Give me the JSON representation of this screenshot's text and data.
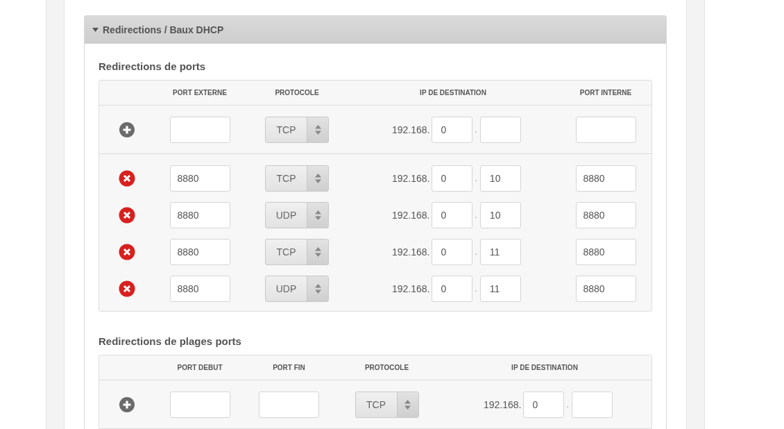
{
  "panel": {
    "title": "Redirections / Baux DHCP",
    "expanded": true
  },
  "port_forwards": {
    "title": "Redirections de ports",
    "columns": [
      "PORT EXTERNE",
      "PROTOCOLE",
      "IP DE DESTINATION",
      "PORT INTERNE"
    ],
    "new_row": {
      "protocol": "TCP",
      "ip_prefix": "192.168.",
      "ip_3": "0",
      "ip_sep": "."
    },
    "rows": [
      {
        "external_port": "8880",
        "protocol": "TCP",
        "ip_prefix": "192.168.",
        "ip_3": "0",
        "ip_sep": ".",
        "ip_4": "10",
        "internal_port": "8880"
      },
      {
        "external_port": "8880",
        "protocol": "UDP",
        "ip_prefix": "192.168.",
        "ip_3": "0",
        "ip_sep": ".",
        "ip_4": "10",
        "internal_port": "8880"
      },
      {
        "external_port": "8880",
        "protocol": "TCP",
        "ip_prefix": "192.168.",
        "ip_3": "0",
        "ip_sep": ".",
        "ip_4": "11",
        "internal_port": "8880"
      },
      {
        "external_port": "8880",
        "protocol": "UDP",
        "ip_prefix": "192.168.",
        "ip_3": "0",
        "ip_sep": ".",
        "ip_4": "11",
        "internal_port": "8880"
      }
    ]
  },
  "range_forwards": {
    "title": "Redirections de plages ports",
    "columns": [
      "PORT DEBUT",
      "PORT FIN",
      "PROTOCOLE",
      "IP DE DESTINATION"
    ],
    "new_row": {
      "protocol": "TCP",
      "ip_prefix": "192.168.",
      "ip_3": "0",
      "ip_sep": "."
    }
  }
}
